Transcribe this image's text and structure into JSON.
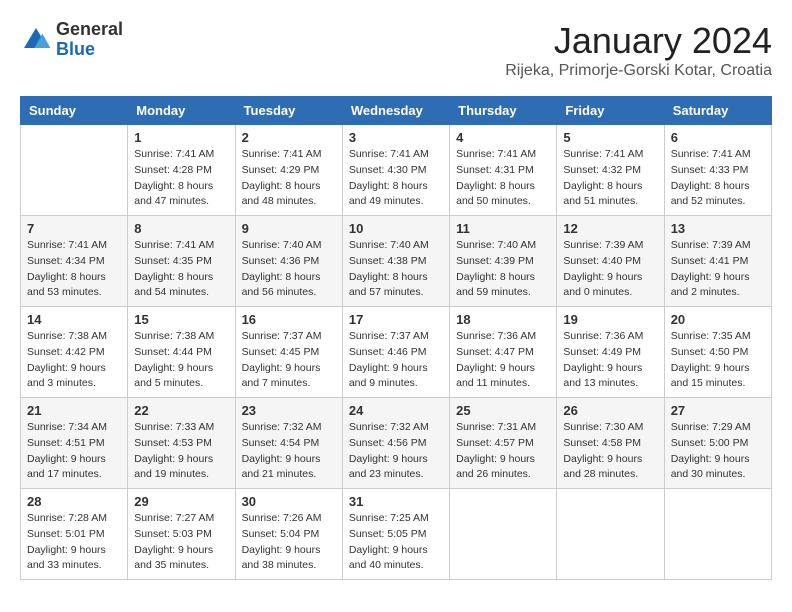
{
  "logo": {
    "general": "General",
    "blue": "Blue"
  },
  "header": {
    "month": "January 2024",
    "location": "Rijeka, Primorje-Gorski Kotar, Croatia"
  },
  "weekdays": [
    "Sunday",
    "Monday",
    "Tuesday",
    "Wednesday",
    "Thursday",
    "Friday",
    "Saturday"
  ],
  "weeks": [
    [
      {
        "day": "",
        "sunrise": "",
        "sunset": "",
        "daylight": ""
      },
      {
        "day": "1",
        "sunrise": "Sunrise: 7:41 AM",
        "sunset": "Sunset: 4:28 PM",
        "daylight": "Daylight: 8 hours and 47 minutes."
      },
      {
        "day": "2",
        "sunrise": "Sunrise: 7:41 AM",
        "sunset": "Sunset: 4:29 PM",
        "daylight": "Daylight: 8 hours and 48 minutes."
      },
      {
        "day": "3",
        "sunrise": "Sunrise: 7:41 AM",
        "sunset": "Sunset: 4:30 PM",
        "daylight": "Daylight: 8 hours and 49 minutes."
      },
      {
        "day": "4",
        "sunrise": "Sunrise: 7:41 AM",
        "sunset": "Sunset: 4:31 PM",
        "daylight": "Daylight: 8 hours and 50 minutes."
      },
      {
        "day": "5",
        "sunrise": "Sunrise: 7:41 AM",
        "sunset": "Sunset: 4:32 PM",
        "daylight": "Daylight: 8 hours and 51 minutes."
      },
      {
        "day": "6",
        "sunrise": "Sunrise: 7:41 AM",
        "sunset": "Sunset: 4:33 PM",
        "daylight": "Daylight: 8 hours and 52 minutes."
      }
    ],
    [
      {
        "day": "7",
        "sunrise": "Sunrise: 7:41 AM",
        "sunset": "Sunset: 4:34 PM",
        "daylight": "Daylight: 8 hours and 53 minutes."
      },
      {
        "day": "8",
        "sunrise": "Sunrise: 7:41 AM",
        "sunset": "Sunset: 4:35 PM",
        "daylight": "Daylight: 8 hours and 54 minutes."
      },
      {
        "day": "9",
        "sunrise": "Sunrise: 7:40 AM",
        "sunset": "Sunset: 4:36 PM",
        "daylight": "Daylight: 8 hours and 56 minutes."
      },
      {
        "day": "10",
        "sunrise": "Sunrise: 7:40 AM",
        "sunset": "Sunset: 4:38 PM",
        "daylight": "Daylight: 8 hours and 57 minutes."
      },
      {
        "day": "11",
        "sunrise": "Sunrise: 7:40 AM",
        "sunset": "Sunset: 4:39 PM",
        "daylight": "Daylight: 8 hours and 59 minutes."
      },
      {
        "day": "12",
        "sunrise": "Sunrise: 7:39 AM",
        "sunset": "Sunset: 4:40 PM",
        "daylight": "Daylight: 9 hours and 0 minutes."
      },
      {
        "day": "13",
        "sunrise": "Sunrise: 7:39 AM",
        "sunset": "Sunset: 4:41 PM",
        "daylight": "Daylight: 9 hours and 2 minutes."
      }
    ],
    [
      {
        "day": "14",
        "sunrise": "Sunrise: 7:38 AM",
        "sunset": "Sunset: 4:42 PM",
        "daylight": "Daylight: 9 hours and 3 minutes."
      },
      {
        "day": "15",
        "sunrise": "Sunrise: 7:38 AM",
        "sunset": "Sunset: 4:44 PM",
        "daylight": "Daylight: 9 hours and 5 minutes."
      },
      {
        "day": "16",
        "sunrise": "Sunrise: 7:37 AM",
        "sunset": "Sunset: 4:45 PM",
        "daylight": "Daylight: 9 hours and 7 minutes."
      },
      {
        "day": "17",
        "sunrise": "Sunrise: 7:37 AM",
        "sunset": "Sunset: 4:46 PM",
        "daylight": "Daylight: 9 hours and 9 minutes."
      },
      {
        "day": "18",
        "sunrise": "Sunrise: 7:36 AM",
        "sunset": "Sunset: 4:47 PM",
        "daylight": "Daylight: 9 hours and 11 minutes."
      },
      {
        "day": "19",
        "sunrise": "Sunrise: 7:36 AM",
        "sunset": "Sunset: 4:49 PM",
        "daylight": "Daylight: 9 hours and 13 minutes."
      },
      {
        "day": "20",
        "sunrise": "Sunrise: 7:35 AM",
        "sunset": "Sunset: 4:50 PM",
        "daylight": "Daylight: 9 hours and 15 minutes."
      }
    ],
    [
      {
        "day": "21",
        "sunrise": "Sunrise: 7:34 AM",
        "sunset": "Sunset: 4:51 PM",
        "daylight": "Daylight: 9 hours and 17 minutes."
      },
      {
        "day": "22",
        "sunrise": "Sunrise: 7:33 AM",
        "sunset": "Sunset: 4:53 PM",
        "daylight": "Daylight: 9 hours and 19 minutes."
      },
      {
        "day": "23",
        "sunrise": "Sunrise: 7:32 AM",
        "sunset": "Sunset: 4:54 PM",
        "daylight": "Daylight: 9 hours and 21 minutes."
      },
      {
        "day": "24",
        "sunrise": "Sunrise: 7:32 AM",
        "sunset": "Sunset: 4:56 PM",
        "daylight": "Daylight: 9 hours and 23 minutes."
      },
      {
        "day": "25",
        "sunrise": "Sunrise: 7:31 AM",
        "sunset": "Sunset: 4:57 PM",
        "daylight": "Daylight: 9 hours and 26 minutes."
      },
      {
        "day": "26",
        "sunrise": "Sunrise: 7:30 AM",
        "sunset": "Sunset: 4:58 PM",
        "daylight": "Daylight: 9 hours and 28 minutes."
      },
      {
        "day": "27",
        "sunrise": "Sunrise: 7:29 AM",
        "sunset": "Sunset: 5:00 PM",
        "daylight": "Daylight: 9 hours and 30 minutes."
      }
    ],
    [
      {
        "day": "28",
        "sunrise": "Sunrise: 7:28 AM",
        "sunset": "Sunset: 5:01 PM",
        "daylight": "Daylight: 9 hours and 33 minutes."
      },
      {
        "day": "29",
        "sunrise": "Sunrise: 7:27 AM",
        "sunset": "Sunset: 5:03 PM",
        "daylight": "Daylight: 9 hours and 35 minutes."
      },
      {
        "day": "30",
        "sunrise": "Sunrise: 7:26 AM",
        "sunset": "Sunset: 5:04 PM",
        "daylight": "Daylight: 9 hours and 38 minutes."
      },
      {
        "day": "31",
        "sunrise": "Sunrise: 7:25 AM",
        "sunset": "Sunset: 5:05 PM",
        "daylight": "Daylight: 9 hours and 40 minutes."
      },
      {
        "day": "",
        "sunrise": "",
        "sunset": "",
        "daylight": ""
      },
      {
        "day": "",
        "sunrise": "",
        "sunset": "",
        "daylight": ""
      },
      {
        "day": "",
        "sunrise": "",
        "sunset": "",
        "daylight": ""
      }
    ]
  ]
}
